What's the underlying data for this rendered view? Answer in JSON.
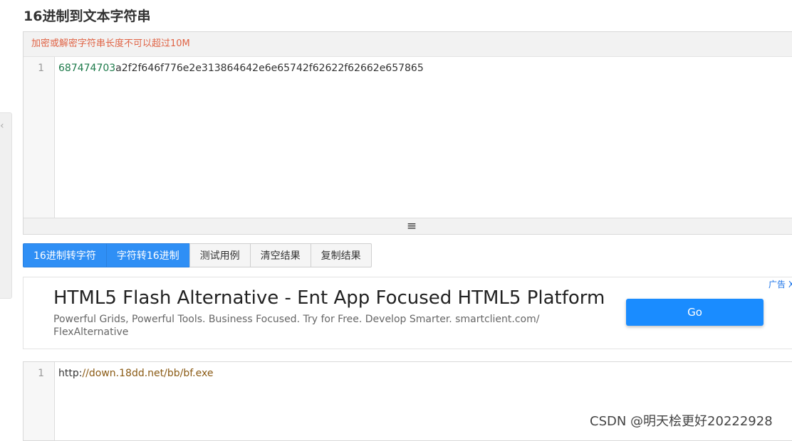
{
  "page": {
    "title": "16进制到文本字符串"
  },
  "notice": {
    "text": "加密或解密字符串长度不可以超过10M"
  },
  "input_editor": {
    "line_number": "1",
    "code_prefix": "687474703",
    "code_rest": "a2f2f646f776e2e313864642e6e65742f62622f62662e657865",
    "resize_icon": "hamburger-icon",
    "resize_glyph": "≡"
  },
  "buttons": {
    "hex_to_text": "16进制转字符",
    "text_to_hex": "字符转16进制",
    "test_case": "测试用例",
    "clear": "清空结果",
    "copy": "复制结果"
  },
  "ad": {
    "title": "HTML5 Flash Alternative - Ent App Focused HTML5 Platform",
    "description": "Powerful Grids, Powerful Tools. Business Focused. Try for Free. Develop Smarter. smartclient.com/ FlexAlternative",
    "cta": "Go",
    "label": "广告 X"
  },
  "output_editor": {
    "line_number": "1",
    "protocol": "http:",
    "path": "//down.18dd.net/bb/bf.exe"
  },
  "watermark": {
    "text": "CSDN @明天桧更好20222928"
  },
  "side_tab": {
    "icon": "chevron-left-icon",
    "glyph": "‹"
  },
  "colors": {
    "primary": "#2f8ff5",
    "notice": "#e06446",
    "go_button": "#1a8cff"
  }
}
